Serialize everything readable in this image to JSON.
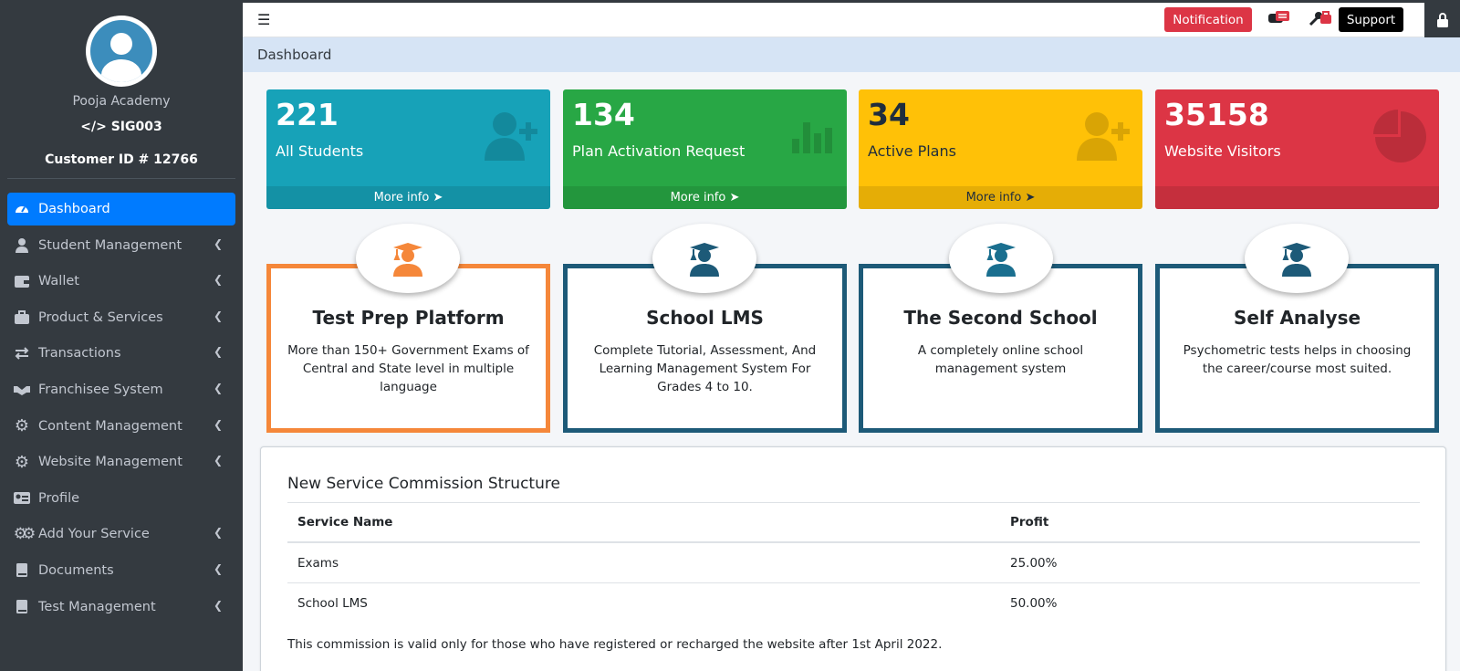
{
  "sidebar": {
    "org_name": "Pooja Academy",
    "org_code": "SIG003",
    "customer_id": "Customer ID # 12766",
    "items": [
      {
        "label": "Dashboard",
        "icon": "tachometer-icon",
        "active": true
      },
      {
        "label": "Student Management",
        "icon": "user-icon"
      },
      {
        "label": "Wallet",
        "icon": "wallet-icon"
      },
      {
        "label": "Product & Services",
        "icon": "briefcase-icon"
      },
      {
        "label": "Transactions",
        "icon": "exchange-icon"
      },
      {
        "label": "Franchisee System",
        "icon": "handshake-icon"
      },
      {
        "label": "Content Management",
        "icon": "gear-icon"
      },
      {
        "label": "Website Management",
        "icon": "gear-icon"
      },
      {
        "label": "Profile",
        "icon": "id-card-icon"
      },
      {
        "label": "Add Your Service",
        "icon": "gears-icon"
      },
      {
        "label": "Documents",
        "icon": "book-icon"
      },
      {
        "label": "Test Management",
        "icon": "book-icon"
      }
    ]
  },
  "topbar": {
    "notification_label": "Notification",
    "support_label": "Support"
  },
  "breadcrumb": "Dashboard",
  "stats": [
    {
      "value": "221",
      "label": "All Students",
      "footer": "More info",
      "color": "#17a2b8"
    },
    {
      "value": "134",
      "label": "Plan Activation Request",
      "footer": "More info",
      "color": "#28a745"
    },
    {
      "value": "34",
      "label": "Active Plans",
      "footer": "More info",
      "color": "#ffc107"
    },
    {
      "value": "35158",
      "label": "Website Visitors",
      "footer": "",
      "color": "#dc3545"
    }
  ],
  "features": [
    {
      "title": "Test Prep Platform",
      "desc": "More than 150+ Government Exams of Central and State level in multiple language",
      "accent": "#f5873a"
    },
    {
      "title": "School LMS",
      "desc": "Complete Tutorial, Assessment, And Learning Management System For Grades 4 to 10.",
      "accent": "#1d5a78"
    },
    {
      "title": "The Second School",
      "desc": "A completely online school management system",
      "accent": "#1d5a78"
    },
    {
      "title": "Self Analyse",
      "desc": "Psychometric tests helps in choosing the career/course most suited.",
      "accent": "#1d5a78"
    }
  ],
  "commission": {
    "title": "New Service Commission Structure",
    "headers": [
      "Service Name",
      "Profit"
    ],
    "rows": [
      [
        "Exams",
        "25.00%"
      ],
      [
        "School LMS",
        "50.00%"
      ]
    ],
    "note": "This commission is valid only for those who have registered or recharged the website after 1st April 2022."
  }
}
